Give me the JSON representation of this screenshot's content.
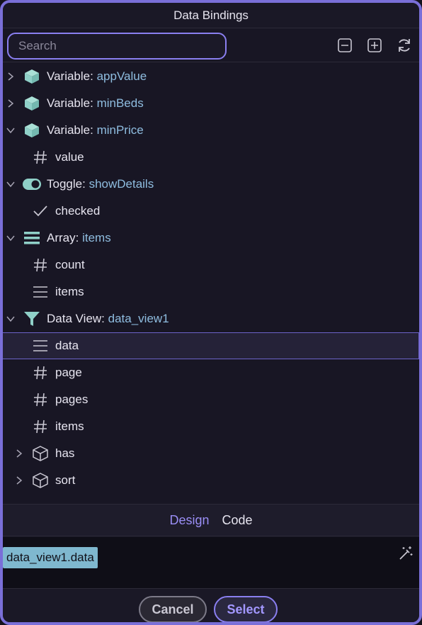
{
  "dialog": {
    "title": "Data Bindings"
  },
  "search": {
    "placeholder": "Search",
    "value": ""
  },
  "toolbar": {
    "collapse_icon": "collapse-all-icon",
    "expand_icon": "expand-all-icon",
    "refresh_icon": "refresh-icon"
  },
  "tree": {
    "rows": [
      {
        "kind": "Variable:",
        "name": "appValue",
        "icon": "cube-filled-icon",
        "expanded": false,
        "level": 0
      },
      {
        "kind": "Variable:",
        "name": "minBeds",
        "icon": "cube-filled-icon",
        "expanded": false,
        "level": 0
      },
      {
        "kind": "Variable:",
        "name": "minPrice",
        "icon": "cube-filled-icon",
        "expanded": true,
        "level": 0
      },
      {
        "label": "value",
        "icon": "hash-icon",
        "level": 1
      },
      {
        "kind": "Toggle:",
        "name": "showDetails",
        "icon": "toggle-icon",
        "expanded": true,
        "level": 0
      },
      {
        "label": "checked",
        "icon": "checkmark-icon",
        "level": 1
      },
      {
        "kind": "Array:",
        "name": "items",
        "icon": "list-icon",
        "expanded": true,
        "level": 0
      },
      {
        "label": "count",
        "icon": "hash-icon",
        "level": 1
      },
      {
        "label": "items",
        "icon": "list-icon",
        "level": 1
      },
      {
        "kind": "Data View:",
        "name": "data_view1",
        "icon": "filter-icon",
        "expanded": true,
        "level": 0
      },
      {
        "label": "data",
        "icon": "list-icon",
        "level": 1,
        "selected": true
      },
      {
        "label": "page",
        "icon": "hash-icon",
        "level": 1
      },
      {
        "label": "pages",
        "icon": "hash-icon",
        "level": 1
      },
      {
        "label": "items",
        "icon": "hash-icon",
        "level": 1
      },
      {
        "label": "has",
        "icon": "cube-outline-icon",
        "level": 1,
        "expanded": false
      },
      {
        "label": "sort",
        "icon": "cube-outline-icon",
        "level": 1,
        "expanded": false
      }
    ]
  },
  "tabs": {
    "design": "Design",
    "code": "Code",
    "active": "Design"
  },
  "expression": {
    "value": "data_view1.data"
  },
  "buttons": {
    "cancel": "Cancel",
    "select": "Select"
  },
  "colors": {
    "accent": "#8a7ff0",
    "binding_name": "#8fbde0",
    "icon_teal": "#8fd0c8",
    "chip_bg": "#7fb8cf"
  }
}
